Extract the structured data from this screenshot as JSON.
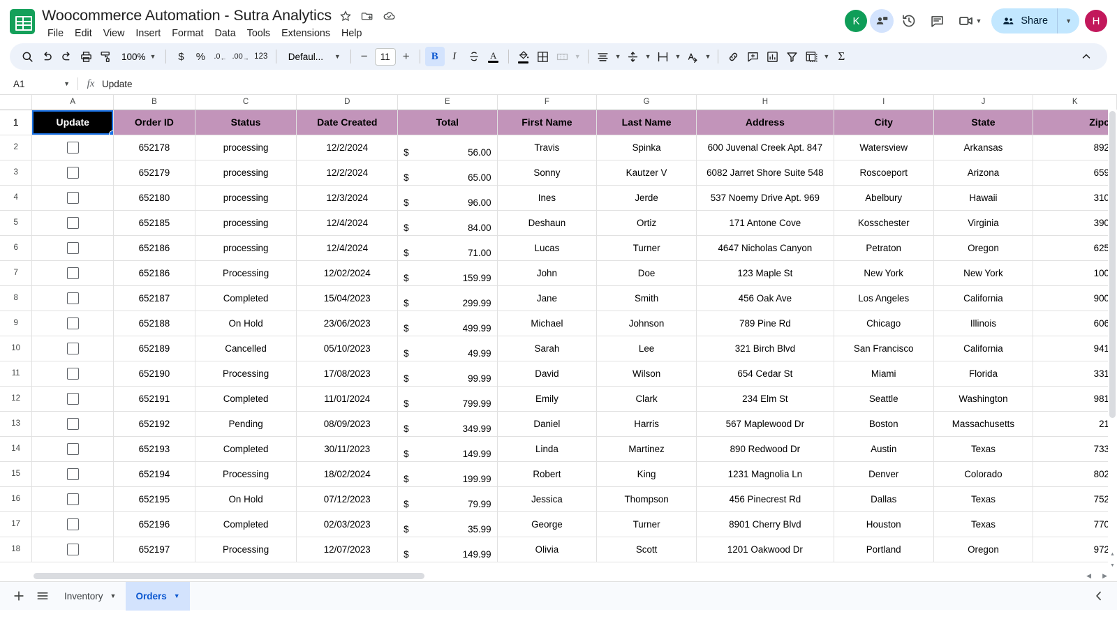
{
  "app": {
    "doc_title": "Woocommerce Automation - Sutra Analytics",
    "logo_icon": "google-sheets-icon",
    "title_icons": [
      {
        "name": "star-icon",
        "glyph": "☆"
      },
      {
        "name": "move-to-folder-icon",
        "glyph": "⬒"
      },
      {
        "name": "cloud-saved-icon",
        "glyph": "☁"
      }
    ],
    "menu": [
      "File",
      "Edit",
      "View",
      "Insert",
      "Format",
      "Data",
      "Tools",
      "Extensions",
      "Help"
    ]
  },
  "topright": {
    "collab_avatar": {
      "name": "collaborator-avatar",
      "letter": "K",
      "color": "#0f9d58"
    },
    "presence_icon": "presence-chip-icon",
    "history_icon": "version-history-icon",
    "comments_icon": "comment-icon",
    "meet_icon": "meet-video-icon",
    "share_label": "Share",
    "share_icon": "share-people-icon",
    "share_bg": "#c2e7ff",
    "user_avatar": {
      "name": "user-avatar",
      "letter": "H",
      "color": "#c2185b"
    }
  },
  "toolbar": {
    "search_icon": "search-icon",
    "undo_icon": "undo-icon",
    "redo_icon": "redo-icon",
    "print_icon": "print-icon",
    "paint_format_icon": "paint-format-icon",
    "zoom_value": "100%",
    "currency_label": "$",
    "percent_label": "%",
    "decrease_decimal_label": ".0",
    "increase_decimal_label": ".00",
    "more_formats_label": "123",
    "font_name": "Defaul...",
    "font_size": "11",
    "decrease_font_label": "−",
    "increase_font_label": "+",
    "bold_label": "B",
    "italic_label": "I",
    "strikethrough_icon": "strikethrough-icon",
    "text_color_label": "A",
    "text_color_swatch": "#000000",
    "fill_color_icon": "fill-color-icon",
    "fill_color_swatch": "#000000",
    "borders_icon": "borders-icon",
    "merge_icon": "merge-cells-icon",
    "halign_icon": "horizontal-align-icon",
    "valign_icon": "vertical-align-icon",
    "wrap_icon": "text-wrap-icon",
    "rotate_icon": "text-rotation-icon",
    "link_icon": "insert-link-icon",
    "comment_icon": "insert-comment-icon",
    "chart_icon": "insert-chart-icon",
    "filter_icon": "create-filter-icon",
    "pivot_icon": "pivot-table-icon",
    "functions_icon": "functions-sigma-icon",
    "functions_label": "Σ",
    "collapse_icon": "collapse-toolbar-icon"
  },
  "formula_bar": {
    "name_box": "A1",
    "fx_label": "fx",
    "value": "Update",
    "placeholder": ""
  },
  "grid": {
    "column_letters": [
      "A",
      "B",
      "C",
      "D",
      "E",
      "F",
      "G",
      "H",
      "I",
      "J",
      "K"
    ],
    "header_fill": "#c294ba",
    "selected_cell": "A1",
    "selected_cell_fill": "#000000",
    "headers": [
      "Update",
      "Order ID",
      "Status",
      "Date Created",
      "Total",
      "First Name",
      "Last Name",
      "Address",
      "City",
      "State",
      "Zipc"
    ],
    "row_numbers": [
      1,
      2,
      3,
      4,
      5,
      6,
      7,
      8,
      9,
      10,
      11,
      12,
      13,
      14,
      15,
      16,
      17,
      18
    ],
    "rows": [
      {
        "n": 2,
        "checkbox": false,
        "order_id": "652178",
        "status": "processing",
        "date": "12/2/2024",
        "currency": "$",
        "total": "56.00",
        "first": "Travis",
        "last": "Spinka",
        "address": "600 Juvenal Creek Apt. 847",
        "city": "Watersview",
        "state": "Arkansas",
        "zip": "892"
      },
      {
        "n": 3,
        "checkbox": false,
        "order_id": "652179",
        "status": "processing",
        "date": "12/2/2024",
        "currency": "$",
        "total": "65.00",
        "first": "Sonny",
        "last": "Kautzer V",
        "address": "6082 Jarret Shore Suite 548",
        "city": "Roscoeport",
        "state": "Arizona",
        "zip": "659"
      },
      {
        "n": 4,
        "checkbox": false,
        "order_id": "652180",
        "status": "processing",
        "date": "12/3/2024",
        "currency": "$",
        "total": "96.00",
        "first": "Ines",
        "last": "Jerde",
        "address": "537 Noemy Drive Apt. 969",
        "city": "Abelbury",
        "state": "Hawaii",
        "zip": "310"
      },
      {
        "n": 5,
        "checkbox": false,
        "order_id": "652185",
        "status": "processing",
        "date": "12/4/2024",
        "currency": "$",
        "total": "84.00",
        "first": "Deshaun",
        "last": "Ortiz",
        "address": "171 Antone Cove",
        "city": "Kosschester",
        "state": "Virginia",
        "zip": "390"
      },
      {
        "n": 6,
        "checkbox": false,
        "order_id": "652186",
        "status": "processing",
        "date": "12/4/2024",
        "currency": "$",
        "total": "71.00",
        "first": "Lucas",
        "last": "Turner",
        "address": "4647 Nicholas Canyon",
        "city": "Petraton",
        "state": "Oregon",
        "zip": "625"
      },
      {
        "n": 7,
        "checkbox": false,
        "order_id": "652186",
        "status": "Processing",
        "date": "12/02/2024",
        "currency": "$",
        "total": "159.99",
        "first": "John",
        "last": "Doe",
        "address": "123 Maple St",
        "city": "New York",
        "state": "New York",
        "zip": "100"
      },
      {
        "n": 8,
        "checkbox": false,
        "order_id": "652187",
        "status": "Completed",
        "date": "15/04/2023",
        "currency": "$",
        "total": "299.99",
        "first": "Jane",
        "last": "Smith",
        "address": "456 Oak Ave",
        "city": "Los Angeles",
        "state": "California",
        "zip": "900"
      },
      {
        "n": 9,
        "checkbox": false,
        "order_id": "652188",
        "status": "On Hold",
        "date": "23/06/2023",
        "currency": "$",
        "total": "499.99",
        "first": "Michael",
        "last": "Johnson",
        "address": "789 Pine Rd",
        "city": "Chicago",
        "state": "Illinois",
        "zip": "606"
      },
      {
        "n": 10,
        "checkbox": false,
        "order_id": "652189",
        "status": "Cancelled",
        "date": "05/10/2023",
        "currency": "$",
        "total": "49.99",
        "first": "Sarah",
        "last": "Lee",
        "address": "321 Birch Blvd",
        "city": "San Francisco",
        "state": "California",
        "zip": "941"
      },
      {
        "n": 11,
        "checkbox": false,
        "order_id": "652190",
        "status": "Processing",
        "date": "17/08/2023",
        "currency": "$",
        "total": "99.99",
        "first": "David",
        "last": "Wilson",
        "address": "654 Cedar St",
        "city": "Miami",
        "state": "Florida",
        "zip": "331"
      },
      {
        "n": 12,
        "checkbox": false,
        "order_id": "652191",
        "status": "Completed",
        "date": "11/01/2024",
        "currency": "$",
        "total": "799.99",
        "first": "Emily",
        "last": "Clark",
        "address": "234 Elm St",
        "city": "Seattle",
        "state": "Washington",
        "zip": "981"
      },
      {
        "n": 13,
        "checkbox": false,
        "order_id": "652192",
        "status": "Pending",
        "date": "08/09/2023",
        "currency": "$",
        "total": "349.99",
        "first": "Daniel",
        "last": "Harris",
        "address": "567 Maplewood Dr",
        "city": "Boston",
        "state": "Massachusetts",
        "zip": "21"
      },
      {
        "n": 14,
        "checkbox": false,
        "order_id": "652193",
        "status": "Completed",
        "date": "30/11/2023",
        "currency": "$",
        "total": "149.99",
        "first": "Linda",
        "last": "Martinez",
        "address": "890 Redwood Dr",
        "city": "Austin",
        "state": "Texas",
        "zip": "733"
      },
      {
        "n": 15,
        "checkbox": false,
        "order_id": "652194",
        "status": "Processing",
        "date": "18/02/2024",
        "currency": "$",
        "total": "199.99",
        "first": "Robert",
        "last": "King",
        "address": "1231 Magnolia Ln",
        "city": "Denver",
        "state": "Colorado",
        "zip": "802"
      },
      {
        "n": 16,
        "checkbox": false,
        "order_id": "652195",
        "status": "On Hold",
        "date": "07/12/2023",
        "currency": "$",
        "total": "79.99",
        "first": "Jessica",
        "last": "Thompson",
        "address": "456 Pinecrest Rd",
        "city": "Dallas",
        "state": "Texas",
        "zip": "752"
      },
      {
        "n": 17,
        "checkbox": false,
        "order_id": "652196",
        "status": "Completed",
        "date": "02/03/2023",
        "currency": "$",
        "total": "35.99",
        "first": "George",
        "last": "Turner",
        "address": "8901 Cherry Blvd",
        "city": "Houston",
        "state": "Texas",
        "zip": "770"
      },
      {
        "n": 18,
        "checkbox": false,
        "order_id": "652197",
        "status": "Processing",
        "date": "12/07/2023",
        "currency": "$",
        "total": "149.99",
        "first": "Olivia",
        "last": "Scott",
        "address": "1201 Oakwood Dr",
        "city": "Portland",
        "state": "Oregon",
        "zip": "972"
      }
    ]
  },
  "bottom": {
    "add_sheet_icon": "add-sheet-icon",
    "all_sheets_icon": "all-sheets-menu-icon",
    "tabs": [
      {
        "label": "Inventory",
        "active": false
      },
      {
        "label": "Orders",
        "active": true
      }
    ],
    "expand_icon": "show-side-panel-icon"
  }
}
